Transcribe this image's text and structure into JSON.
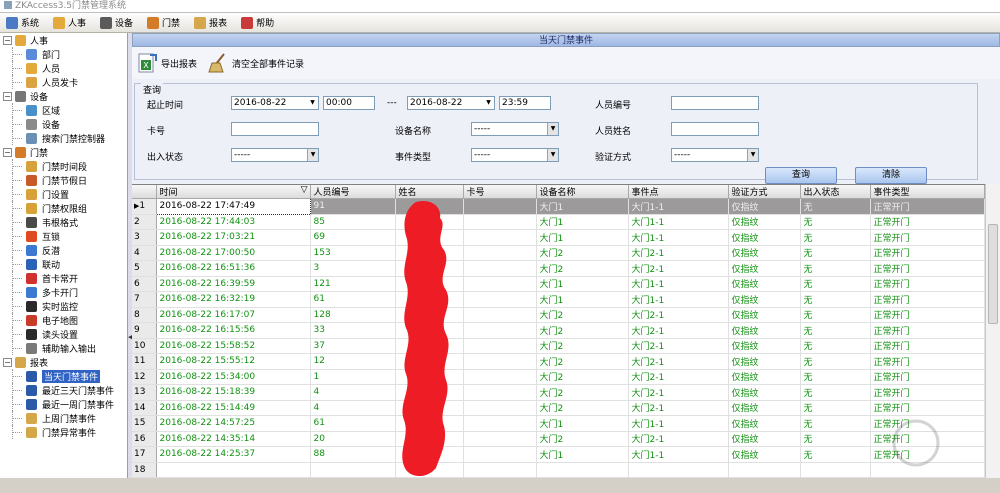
{
  "window": {
    "title": "ZKAccess3.5门禁管理系统"
  },
  "menu": [
    {
      "label": "系统",
      "icon": "system-icon",
      "color": "#4b79c4"
    },
    {
      "label": "人事",
      "icon": "person-icon",
      "color": "#e3a93b"
    },
    {
      "label": "设备",
      "icon": "gear-icon",
      "color": "#5a5a5a"
    },
    {
      "label": "门禁",
      "icon": "door-icon",
      "color": "#d47b2a"
    },
    {
      "label": "报表",
      "icon": "report-icon",
      "color": "#d6a64a"
    },
    {
      "label": "帮助",
      "icon": "help-icon",
      "color": "#c93a3a"
    }
  ],
  "sidebar": {
    "groups": [
      {
        "label": "人事",
        "expander": "−",
        "icon": "person-group-icon",
        "color": "#e3a93b",
        "items": [
          {
            "label": "部门",
            "icon": "department-icon",
            "color": "#5b8ad8"
          },
          {
            "label": "人员",
            "icon": "person-icon",
            "color": "#e3a93b"
          },
          {
            "label": "人员发卡",
            "icon": "card-issue-icon",
            "color": "#d9a441"
          }
        ]
      },
      {
        "label": "设备",
        "expander": "−",
        "icon": "device-group-icon",
        "color": "#777777",
        "items": [
          {
            "label": "区域",
            "icon": "area-icon",
            "color": "#4a90c8"
          },
          {
            "label": "设备",
            "icon": "gear-icon",
            "color": "#8a8a8a"
          },
          {
            "label": "搜索门禁控制器",
            "icon": "search-icon",
            "color": "#6b8fb5"
          }
        ]
      },
      {
        "label": "门禁",
        "expander": "−",
        "icon": "door-group-icon",
        "color": "#d47b2a",
        "items": [
          {
            "label": "门禁时间段",
            "icon": "timezone-icon",
            "color": "#d7a23a"
          },
          {
            "label": "门禁节假日",
            "icon": "holiday-icon",
            "color": "#c85a2a"
          },
          {
            "label": "门设置",
            "icon": "door-setting-icon",
            "color": "#d7a23a"
          },
          {
            "label": "门禁权限组",
            "icon": "access-level-icon",
            "color": "#d7a23a"
          },
          {
            "label": "韦根格式",
            "icon": "wiegand-icon",
            "color": "#4a4a4a"
          },
          {
            "label": "互锁",
            "icon": "interlock-icon",
            "color": "#e04a20"
          },
          {
            "label": "反潜",
            "icon": "anti-passback-icon",
            "color": "#3a7ad0"
          },
          {
            "label": "联动",
            "icon": "linkage-icon",
            "color": "#2a62b8"
          },
          {
            "label": "首卡常开",
            "icon": "first-card-icon",
            "color": "#d03030"
          },
          {
            "label": "多卡开门",
            "icon": "multi-card-icon",
            "color": "#3a7ad0"
          },
          {
            "label": "实时监控",
            "icon": "monitor-icon",
            "color": "#2a2a2a"
          },
          {
            "label": "电子地图",
            "icon": "map-icon",
            "color": "#c83a2a"
          },
          {
            "label": "读头设置",
            "icon": "reader-icon",
            "color": "#2a2a2a"
          },
          {
            "label": "辅助输入输出",
            "icon": "aux-io-icon",
            "color": "#7a7a7a"
          }
        ]
      },
      {
        "label": "报表",
        "expander": "−",
        "icon": "report-group-icon",
        "color": "#d6a64a",
        "items": [
          {
            "label": "当天门禁事件",
            "icon": "today-events-icon",
            "color": "#2a5aa8",
            "selected": true
          },
          {
            "label": "最近三天门禁事件",
            "icon": "three-days-events-icon",
            "color": "#2a5aa8"
          },
          {
            "label": "最近一周门禁事件",
            "icon": "week-events-icon",
            "color": "#2a5aa8"
          },
          {
            "label": "上周门禁事件",
            "icon": "last-week-events-icon",
            "color": "#d6a64a"
          },
          {
            "label": "门禁异常事件",
            "icon": "exception-events-icon",
            "color": "#d6a64a"
          }
        ]
      }
    ]
  },
  "panel": {
    "title": "当天门禁事件"
  },
  "toolbar": {
    "export_label": "导出报表",
    "clear_label": "清空全部事件记录"
  },
  "query": {
    "legend": "查询",
    "start_time_label": "起止时间",
    "start_date": "2016-08-22",
    "start_time": "00:00",
    "range_sep": "---",
    "end_date": "2016-08-22",
    "end_time": "23:59",
    "person_no_label": "人员编号",
    "person_no_value": "",
    "card_label": "卡号",
    "card_value": "",
    "device_name_label": "设备名称",
    "device_name_value": "-----",
    "person_name_label": "人员姓名",
    "person_name_value": "",
    "io_state_label": "出入状态",
    "io_state_value": "-----",
    "event_type_label": "事件类型",
    "event_type_value": "-----",
    "verify_label": "验证方式",
    "verify_value": "-----",
    "search_button": "查询",
    "clear_button": "清除"
  },
  "grid": {
    "columns": [
      "时间",
      "人员编号",
      "姓名",
      "卡号",
      "设备名称",
      "事件点",
      "验证方式",
      "出入状态",
      "事件类型"
    ],
    "sort_column": "时间",
    "rows": [
      {
        "n": "1",
        "time": "2016-08-22 17:47:49",
        "pid": "91",
        "name": "",
        "card": "",
        "device": "大门1",
        "point": "大门1-1",
        "verify": "仅指纹",
        "io": "无",
        "type": "正常开门"
      },
      {
        "n": "2",
        "time": "2016-08-22 17:44:03",
        "pid": "85",
        "name": "",
        "card": "",
        "device": "大门1",
        "point": "大门1-1",
        "verify": "仅指纹",
        "io": "无",
        "type": "正常开门"
      },
      {
        "n": "3",
        "time": "2016-08-22 17:03:21",
        "pid": "69",
        "name": "",
        "card": "",
        "device": "大门1",
        "point": "大门1-1",
        "verify": "仅指纹",
        "io": "无",
        "type": "正常开门"
      },
      {
        "n": "4",
        "time": "2016-08-22 17:00:50",
        "pid": "153",
        "name": "",
        "card": "",
        "device": "大门2",
        "point": "大门2-1",
        "verify": "仅指纹",
        "io": "无",
        "type": "正常开门"
      },
      {
        "n": "5",
        "time": "2016-08-22 16:51:36",
        "pid": "3",
        "name": "",
        "card": "",
        "device": "大门2",
        "point": "大门2-1",
        "verify": "仅指纹",
        "io": "无",
        "type": "正常开门"
      },
      {
        "n": "6",
        "time": "2016-08-22 16:39:59",
        "pid": "121",
        "name": "",
        "card": "",
        "device": "大门1",
        "point": "大门1-1",
        "verify": "仅指纹",
        "io": "无",
        "type": "正常开门"
      },
      {
        "n": "7",
        "time": "2016-08-22 16:32:19",
        "pid": "61",
        "name": "",
        "card": "",
        "device": "大门1",
        "point": "大门1-1",
        "verify": "仅指纹",
        "io": "无",
        "type": "正常开门"
      },
      {
        "n": "8",
        "time": "2016-08-22 16:17:07",
        "pid": "128",
        "name": "",
        "card": "",
        "device": "大门2",
        "point": "大门2-1",
        "verify": "仅指纹",
        "io": "无",
        "type": "正常开门"
      },
      {
        "n": "9",
        "time": "2016-08-22 16:15:56",
        "pid": "33",
        "name": "",
        "card": "",
        "device": "大门2",
        "point": "大门2-1",
        "verify": "仅指纹",
        "io": "无",
        "type": "正常开门"
      },
      {
        "n": "10",
        "time": "2016-08-22 15:58:52",
        "pid": "37",
        "name": "",
        "card": "",
        "device": "大门2",
        "point": "大门2-1",
        "verify": "仅指纹",
        "io": "无",
        "type": "正常开门"
      },
      {
        "n": "11",
        "time": "2016-08-22 15:55:12",
        "pid": "12",
        "name": "",
        "card": "",
        "device": "大门2",
        "point": "大门2-1",
        "verify": "仅指纹",
        "io": "无",
        "type": "正常开门"
      },
      {
        "n": "12",
        "time": "2016-08-22 15:34:00",
        "pid": "1",
        "name": "",
        "card": "",
        "device": "大门2",
        "point": "大门2-1",
        "verify": "仅指纹",
        "io": "无",
        "type": "正常开门"
      },
      {
        "n": "13",
        "time": "2016-08-22 15:18:39",
        "pid": "4",
        "name": "",
        "card": "",
        "device": "大门2",
        "point": "大门2-1",
        "verify": "仅指纹",
        "io": "无",
        "type": "正常开门"
      },
      {
        "n": "14",
        "time": "2016-08-22 15:14:49",
        "pid": "4",
        "name": "",
        "card": "",
        "device": "大门2",
        "point": "大门2-1",
        "verify": "仅指纹",
        "io": "无",
        "type": "正常开门"
      },
      {
        "n": "15",
        "time": "2016-08-22 14:57:25",
        "pid": "61",
        "name": "",
        "card": "",
        "device": "大门1",
        "point": "大门1-1",
        "verify": "仅指纹",
        "io": "无",
        "type": "正常开门"
      },
      {
        "n": "16",
        "time": "2016-08-22 14:35:14",
        "pid": "20",
        "name": "",
        "card": "",
        "device": "大门2",
        "point": "大门2-1",
        "verify": "仅指纹",
        "io": "无",
        "type": "正常开门"
      },
      {
        "n": "17",
        "time": "2016-08-22 14:25:37",
        "pid": "88",
        "name": "",
        "card": "",
        "device": "大门1",
        "point": "大门1-1",
        "verify": "仅指纹",
        "io": "无",
        "type": "正常开门"
      },
      {
        "n": "18",
        "time": "",
        "pid": "",
        "name": "",
        "card": "",
        "device": "",
        "point": "",
        "verify": "",
        "io": "",
        "type": ""
      }
    ],
    "selected_row": 0
  },
  "colors": {
    "accent": "#3163c5",
    "row_text": "#129212",
    "redaction": "#ee1c24"
  }
}
